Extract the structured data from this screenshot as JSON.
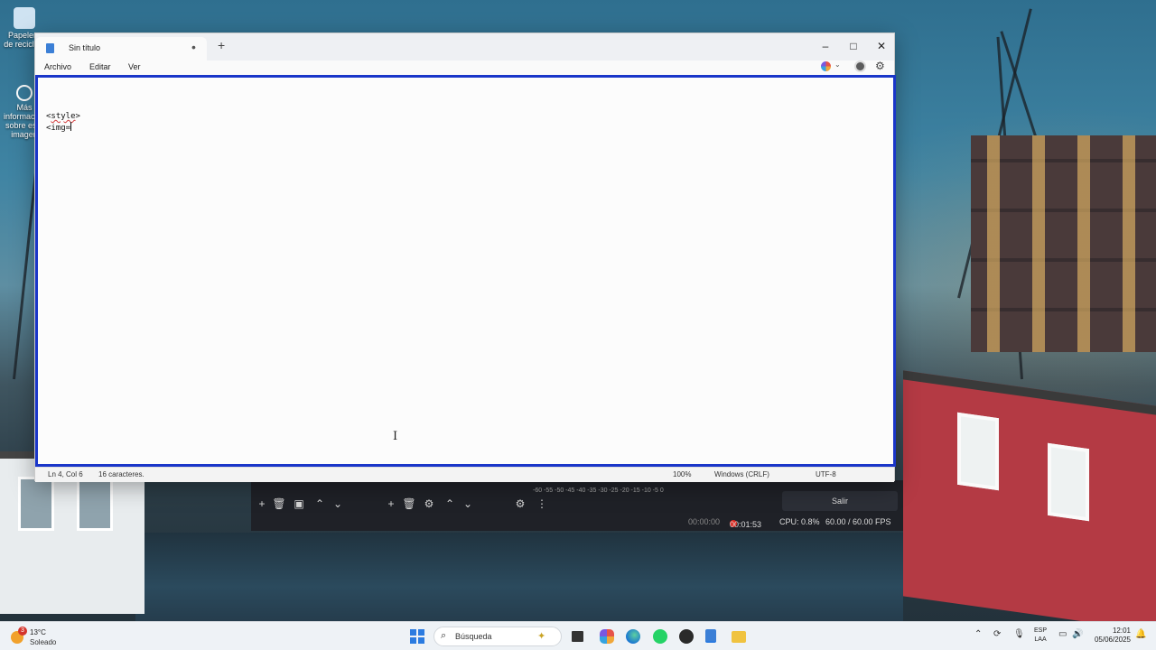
{
  "desktop": {
    "icons": [
      {
        "label": "Papelera de reciclaje",
        "icon": "recycle-bin-icon"
      },
      {
        "label": "Más información sobre esta imagen",
        "icon": "info-icon"
      }
    ]
  },
  "notepad": {
    "tab_title": "Sin título",
    "tab_modified_indicator": "•",
    "new_tab": "+",
    "controls": {
      "minimize": "–",
      "maximize": "□",
      "close": "✕"
    },
    "menu": [
      "Archivo",
      "Editar",
      "Ver"
    ],
    "editor": {
      "lines": [
        "",
        "",
        "<style>",
        "<img="
      ],
      "squiggle_word": "style"
    },
    "status": {
      "position": "Ln 4, Col 6",
      "chars": "16 caracteres.",
      "zoom": "100%",
      "line_ending": "Windows (CRLF)",
      "encoding": "UTF-8"
    }
  },
  "obs": {
    "meter_ticks": "-60 -55 -50 -45 -40 -35 -30 -25 -20 -15 -10 -5 0",
    "exit_label": "Salir",
    "stream_time": "00:00:00",
    "rec_time": "00:01:53",
    "cpu": "CPU: 0.8%",
    "fps": "60.00 / 60.00 FPS"
  },
  "taskbar": {
    "weather_badge": "3",
    "temperature": "13°C",
    "condition": "Soleado",
    "search_label": "Búsqueda",
    "lang_line1": "ESP",
    "lang_line2": "LAA",
    "time": "12:01",
    "date": "05/06/2025",
    "colors": {
      "accent": "#2b7be0",
      "selection_border": "#1a36c9",
      "rec": "#e0271e"
    }
  }
}
